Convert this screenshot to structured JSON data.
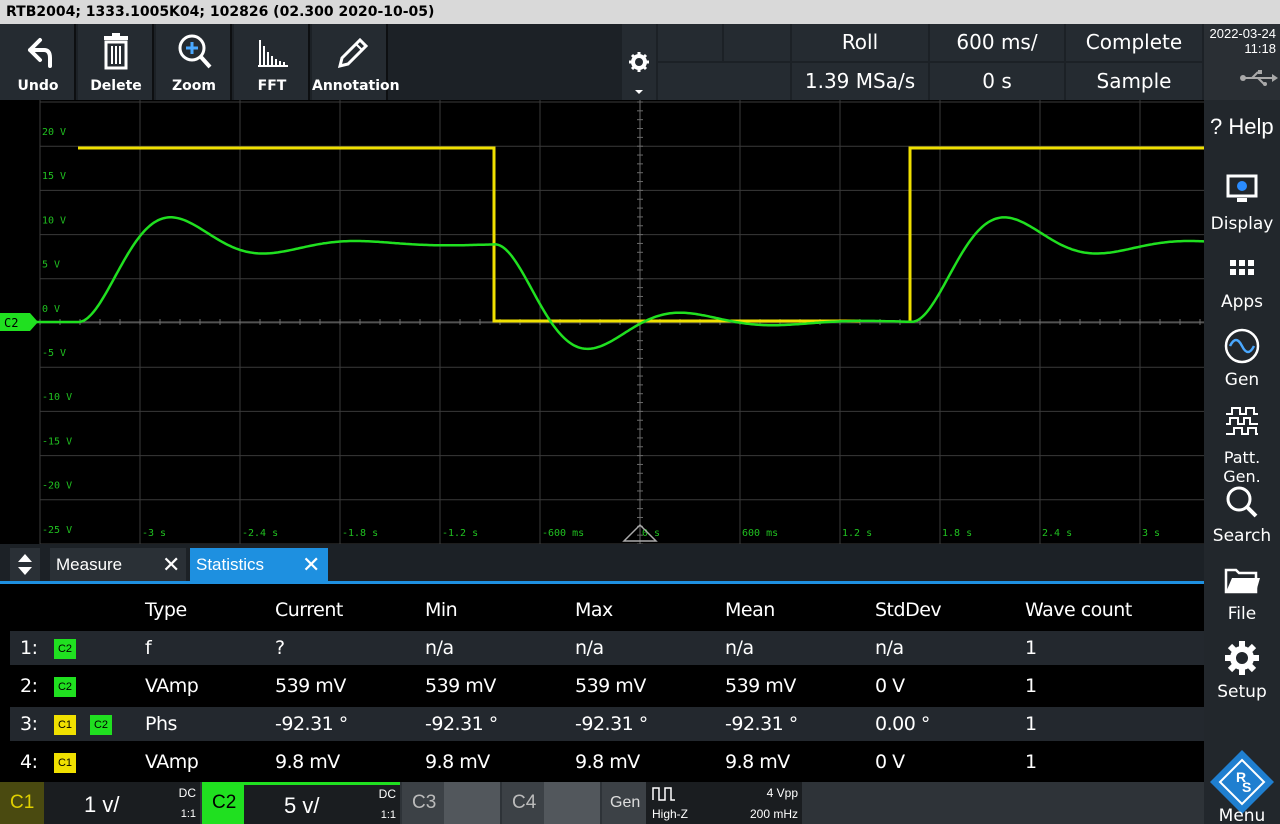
{
  "title_bar": "RTB2004; 1333.1005K04; 102826 (02.300 2020-10-05)",
  "toolbar": {
    "undo": "Undo",
    "delete": "Delete",
    "zoom": "Zoom",
    "fft": "FFT",
    "annotation": "Annotation"
  },
  "acquisition": {
    "mode": "Roll",
    "timebase": "600 ms/",
    "status": "Complete",
    "sample_rate": "1.39 MSa/s",
    "trigger_offset": "0 s",
    "acq_type": "Sample"
  },
  "datetime": {
    "date": "2022-03-24",
    "time": "11:18"
  },
  "sidebar": {
    "help": "Help",
    "display": "Display",
    "apps": "Apps",
    "gen": "Gen",
    "patt_gen": "Patt. Gen.",
    "search": "Search",
    "file": "File",
    "setup": "Setup",
    "menu": "Menu"
  },
  "scope": {
    "y_labels": [
      "20 V",
      "15 V",
      "10 V",
      "5 V",
      "0 V",
      "-5 V",
      "-10 V",
      "-15 V",
      "-20 V",
      "-25 V"
    ],
    "x_labels": [
      "-3 s",
      "-2.4 s",
      "-1.8 s",
      "-1.2 s",
      "-600 ms",
      "0 s",
      "600 ms",
      "1.2 s",
      "1.8 s",
      "2.4 s",
      "3 s"
    ],
    "channel_marker": "C2",
    "colors": {
      "c1": "#f0e000",
      "c2": "#20e020",
      "grid": "#3a3a3a"
    }
  },
  "tabs": {
    "measure": "Measure",
    "statistics": "Statistics",
    "close": "✕"
  },
  "measure_table": {
    "headers": [
      "Type",
      "Current",
      "Min",
      "Max",
      "Mean",
      "StdDev",
      "Wave count"
    ],
    "rows": [
      {
        "num": "1:",
        "src1": "C2",
        "src2": "",
        "type": "f",
        "current": "?",
        "min": "n/a",
        "max": "n/a",
        "mean": "n/a",
        "stddev": "n/a",
        "count": "1"
      },
      {
        "num": "2:",
        "src1": "C2",
        "src2": "",
        "type": "VAmp",
        "current": "539 mV",
        "min": "539 mV",
        "max": "539 mV",
        "mean": "539 mV",
        "stddev": "0 V",
        "count": "1"
      },
      {
        "num": "3:",
        "src1": "C1",
        "src2": "C2",
        "type": "Phs",
        "current": "-92.31 °",
        "min": "-92.31 °",
        "max": "-92.31 °",
        "mean": "-92.31 °",
        "stddev": "0.00 °",
        "count": "1"
      },
      {
        "num": "4:",
        "src1": "C1",
        "src2": "",
        "type": "VAmp",
        "current": "9.8 mV",
        "min": "9.8 mV",
        "max": "9.8 mV",
        "mean": "9.8 mV",
        "stddev": "0 V",
        "count": "1"
      }
    ]
  },
  "channels": {
    "c1": {
      "name": "C1",
      "scale": "1 v/",
      "coupling": "DC",
      "ratio": "1:1"
    },
    "c2": {
      "name": "C2",
      "scale": "5 v/",
      "coupling": "DC",
      "ratio": "1:1"
    },
    "c3": {
      "name": "C3"
    },
    "c4": {
      "name": "C4"
    },
    "gen": {
      "name": "Gen",
      "impedance": "High-Z",
      "amplitude": "4 Vpp",
      "frequency": "200 mHz"
    }
  }
}
